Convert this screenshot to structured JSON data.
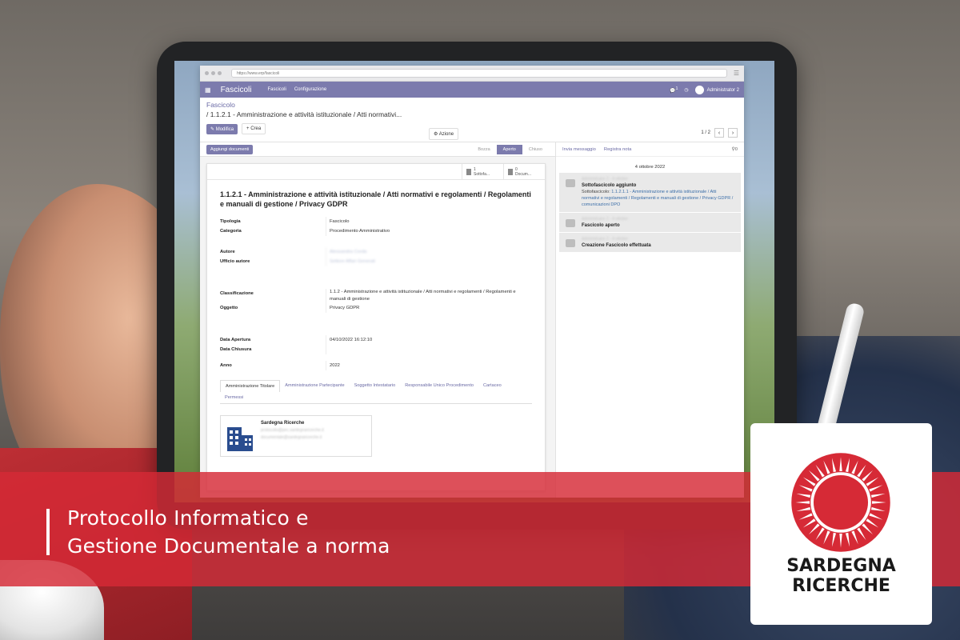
{
  "browser": {
    "url": "https://www.erp/fascicoli"
  },
  "navbar": {
    "app_name": "Fascicoli",
    "menu": [
      "Fascicoli",
      "Configurazione"
    ],
    "user": "Administrator 2",
    "chat_count": "1"
  },
  "control": {
    "breadcrumb_parent": "Fascicolo",
    "breadcrumb_current": "/ 1.1.2.1 - Amministrazione e attività istituzionale / Atti normativi...",
    "edit_label": "Modifica",
    "create_label": "Crea",
    "action_label": "Azione",
    "pager": "1 / 2"
  },
  "statusbar": {
    "add_documents": "Aggiungi documenti",
    "stages": [
      "Bozza",
      "Aperto",
      "Chiuso"
    ],
    "active_stage": "Aperto"
  },
  "sheet": {
    "smart_buttons": [
      {
        "count": "1",
        "label": "Sottofa..."
      },
      {
        "count": "0",
        "label": "Docum..."
      }
    ],
    "title": "1.1.2.1 - Amministrazione e attività istituzionale / Atti normativi e regolamenti / Regolamenti e manuali di gestione / Privacy GDPR",
    "fields": {
      "tipologia": {
        "label": "Tipologia",
        "value": "Fascicolo"
      },
      "categoria": {
        "label": "Categoria",
        "value": "Procedimento Amministrativo"
      },
      "autore": {
        "label": "Autore",
        "value": "Alessandra Corda"
      },
      "ufficio": {
        "label": "Ufficio autore",
        "value": "Settore Affari Generali"
      },
      "classificazione": {
        "label": "Classificazione",
        "value": "1.1.2 - Amministrazione e attività istituzionale / Atti normativi e regolamenti / Regolamenti e manuali di gestione"
      },
      "oggetto": {
        "label": "Oggetto",
        "value": "Privacy GDPR"
      },
      "data_apertura": {
        "label": "Data Apertura",
        "value": "04/10/2022 16:12:10"
      },
      "data_chiusura": {
        "label": "Data Chiusura",
        "value": ""
      },
      "anno": {
        "label": "Anno",
        "value": "2022"
      }
    },
    "tabs": [
      "Amministrazione Titolare",
      "Amministrazione Partecipante",
      "Soggetto Intestatario",
      "Responsabile Unico Procedimento",
      "Cartaceo",
      "Permessi"
    ],
    "card": {
      "name": "Sardegna Ricerche",
      "line1": "protocollo@pec.sardegnaricerche.it",
      "line2": "documentale@sardegnaricerche.it"
    }
  },
  "chatter": {
    "send_message": "Invia messaggio",
    "log_note": "Registra nota",
    "attachments": "0",
    "date": "4 ottobre 2022",
    "messages": [
      {
        "author": "Administrator 2 - 4 ottobre",
        "title": "Sottofascicolo aggiunto",
        "body_prefix": "Sottofascicolo: ",
        "body_link": "1.1.2.1.1 - Amministrazione e attività istituzionale / Atti normativi e regolamenti / Regolamenti e manuali di gestione / Privacy GDPR / comunicazioni DPO"
      },
      {
        "author": "Administrator 2 - 4 ottobre",
        "title": "Fascicolo aperto"
      },
      {
        "author": "Administrator 2 - 4 ottobre",
        "title": "Creazione Fascicolo effettuata"
      }
    ]
  },
  "banner": {
    "line1": "Protocollo Informatico e",
    "line2": "Gestione Documentale a norma"
  },
  "logo": {
    "line1": "SARDEGNA",
    "line2": "RICERCHE",
    "color": "#d62a36"
  }
}
